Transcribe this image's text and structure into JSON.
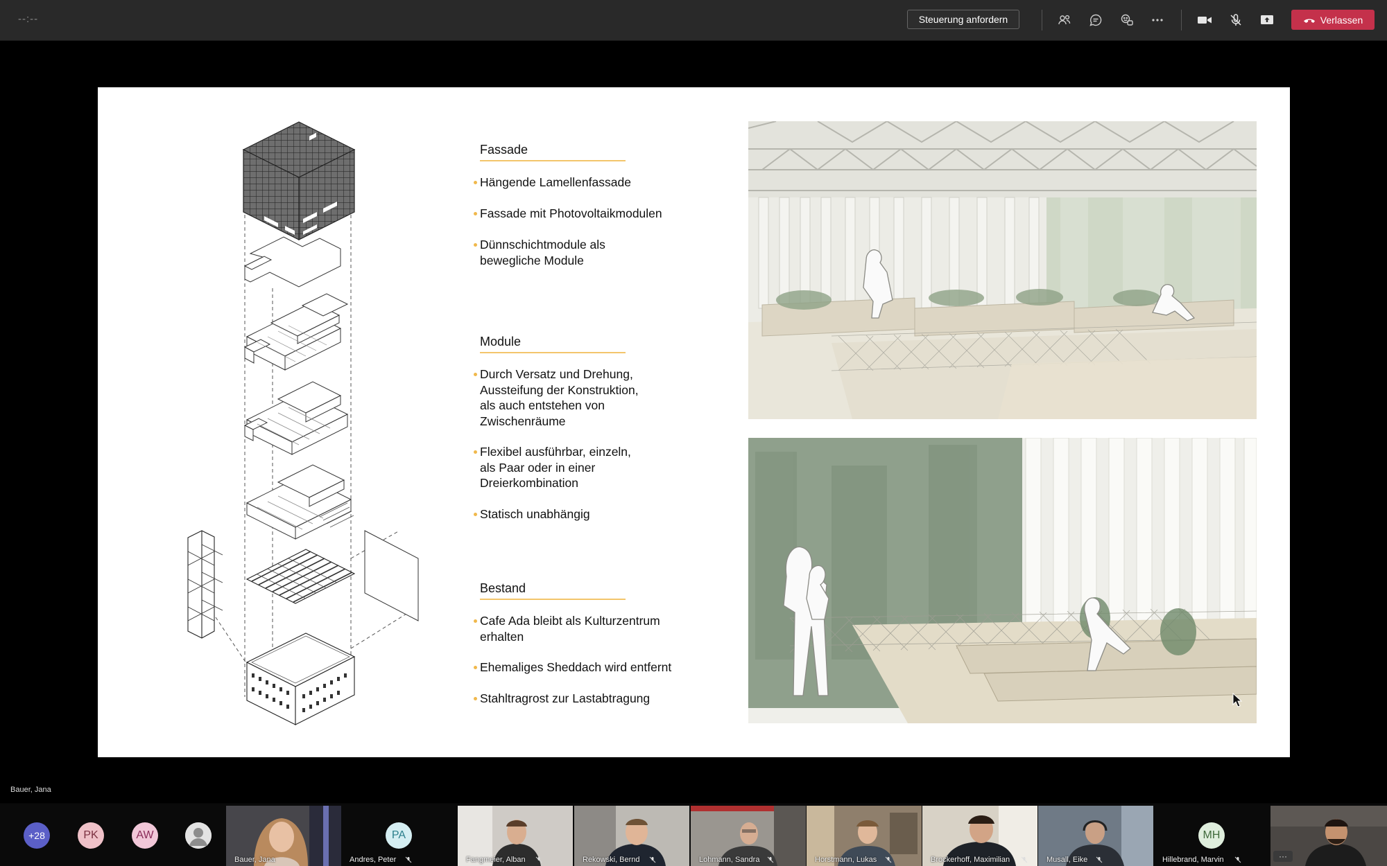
{
  "call": {
    "timer": "--:--",
    "request_control_label": "Steuerung anfordern",
    "leave_label": "Verlassen",
    "presenter_label": "Bauer, Jana",
    "accent_color": "#c4314b"
  },
  "toolbar_icons": [
    "participants-icon",
    "chat-icon",
    "reactions-icon",
    "more-options-icon",
    "camera-icon",
    "mic-off-icon",
    "share-screen-icon"
  ],
  "slide": {
    "sections": [
      {
        "title": "Fassade",
        "bullets": [
          {
            "lines": [
              "Hängende Lamellenfassade"
            ]
          },
          {
            "lines": [
              "Fassade mit Photovoltaikmodulen"
            ]
          },
          {
            "lines": [
              "Dünnschichtmodule als",
              "bewegliche Module"
            ]
          }
        ]
      },
      {
        "title": "Module",
        "bullets": [
          {
            "lines": [
              "Durch Versatz und Drehung,",
              "Aussteifung der Konstruktion,",
              "als auch entstehen von",
              "Zwischenräume"
            ]
          },
          {
            "lines": [
              "Flexibel ausführbar, einzeln,",
              "als Paar oder in einer",
              "Dreierkombination"
            ]
          },
          {
            "lines": [
              "Statisch unabhängig"
            ]
          }
        ]
      },
      {
        "title": "Bestand",
        "bullets": [
          {
            "lines": [
              "Cafe Ada bleibt als Kulturzentrum",
              "erhalten"
            ]
          },
          {
            "lines": [
              "Ehemaliges Sheddach wird entfernt"
            ]
          },
          {
            "lines": [
              "Stahltragrost zur Lastabtragung"
            ]
          }
        ]
      }
    ]
  },
  "participants": {
    "overflow_count": "+28",
    "avatars": [
      {
        "initials": "PK",
        "color": "#efc1c8",
        "text_color": "#7a3040"
      },
      {
        "initials": "AW",
        "color": "#f1c7d8",
        "text_color": "#8a2d5a"
      }
    ],
    "tiles": [
      {
        "name": "Bauer, Jana",
        "video": true,
        "muted": false
      },
      {
        "name": "Andres, Peter",
        "video": false,
        "initials": "PA",
        "muted": true
      },
      {
        "name": "Fangmeier, Alban",
        "video": true,
        "muted": true
      },
      {
        "name": "Rekowski, Bernd",
        "video": true,
        "muted": true
      },
      {
        "name": "Lohmann, Sandra",
        "video": true,
        "muted": true
      },
      {
        "name": "Horstmann, Lukas",
        "video": true,
        "muted": true
      },
      {
        "name": "Brockerhoff, Maximilian",
        "video": true,
        "muted": true
      },
      {
        "name": "Musall, Eike",
        "video": true,
        "muted": true
      },
      {
        "name": "Hillebrand, Marvin",
        "video": false,
        "initials": "MH",
        "muted": true
      }
    ]
  }
}
